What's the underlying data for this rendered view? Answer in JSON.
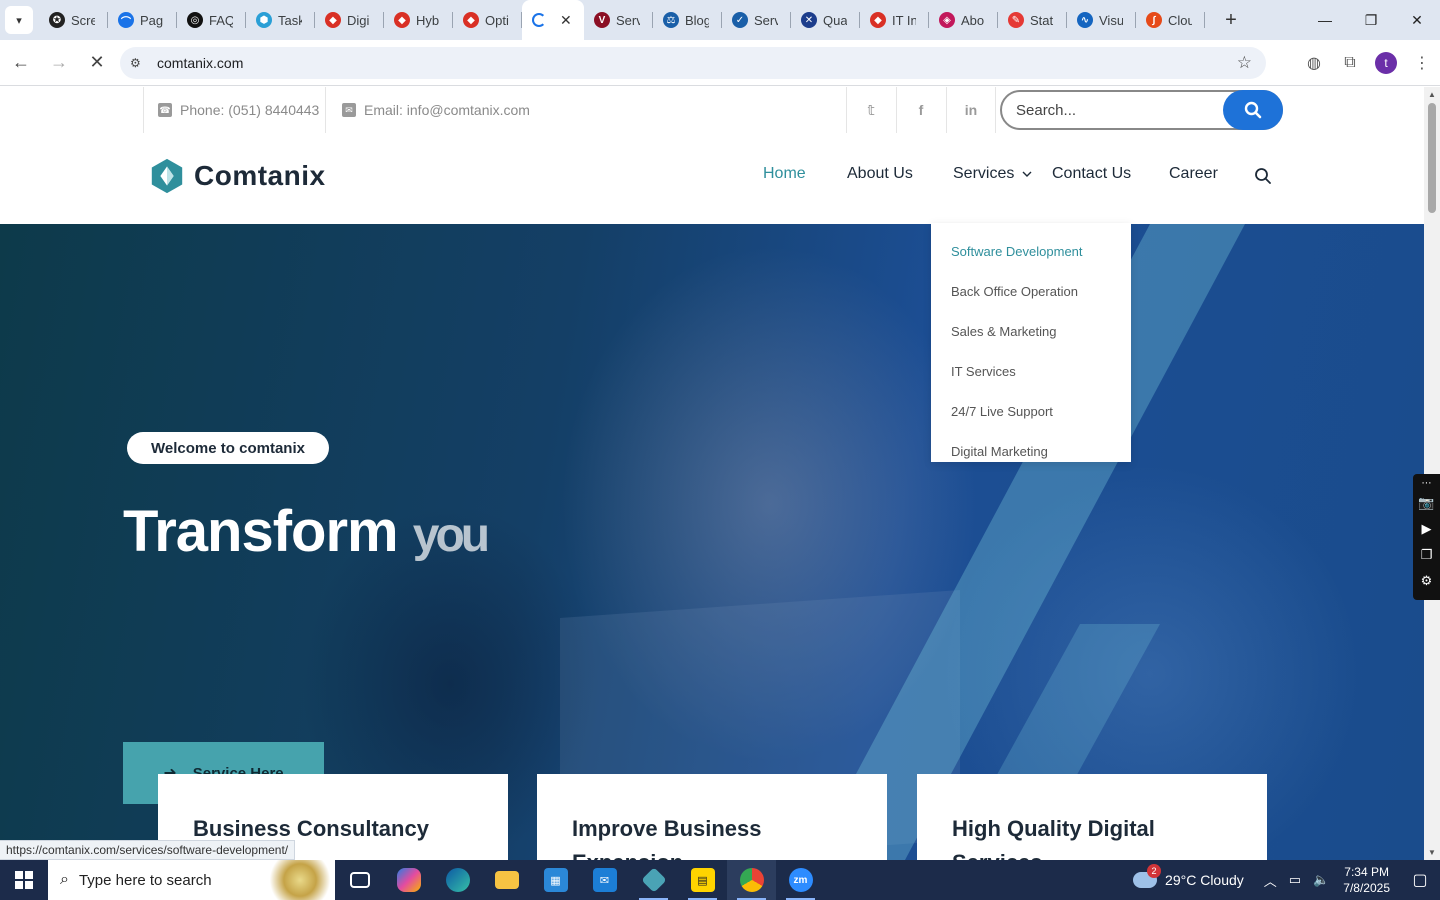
{
  "browser": {
    "tabs": [
      {
        "label": "Scre",
        "color": "#222222",
        "glyph": "✪"
      },
      {
        "label": "Pag",
        "color": "#1a73e8",
        "glyph": "⌒"
      },
      {
        "label": "FAQ",
        "color": "#111111",
        "glyph": "◎"
      },
      {
        "label": "Task",
        "color": "#2a9fd6",
        "glyph": "⬢"
      },
      {
        "label": "Digi",
        "color": "#d93025",
        "glyph": "◆"
      },
      {
        "label": "Hyb",
        "color": "#d93025",
        "glyph": "◆"
      },
      {
        "label": "Opti",
        "color": "#d93025",
        "glyph": "◆"
      },
      {
        "label": "Serv",
        "color": "#8b0f24",
        "glyph": "V"
      },
      {
        "label": "Blog",
        "color": "#1a5fa8",
        "glyph": "⚖"
      },
      {
        "label": "Serv",
        "color": "#1a5fa8",
        "glyph": "✓"
      },
      {
        "label": "Qua",
        "color": "#1c3d8c",
        "glyph": "✕"
      },
      {
        "label": "IT In",
        "color": "#d93025",
        "glyph": "◆"
      },
      {
        "label": "Abo",
        "color": "#c2185b",
        "glyph": "◈"
      },
      {
        "label": "Stat",
        "color": "#e53935",
        "glyph": "✎"
      },
      {
        "label": "Visu",
        "color": "#1565c0",
        "glyph": "∿"
      },
      {
        "label": "Clou",
        "color": "#e64a19",
        "glyph": "∫"
      }
    ],
    "url": "comtanix.com",
    "status_link": "https://comtanix.com/services/software-development/"
  },
  "topbar": {
    "phone": "Phone: (051) 8440443",
    "email": "Email: info@comtanix.com",
    "social": [
      "twitter",
      "facebook",
      "linkedin"
    ],
    "search_placeholder": "Search..."
  },
  "header": {
    "logo_text": "Comtanix",
    "brand_color": "#2f8f9c",
    "nav": [
      {
        "label": "Home",
        "active": true
      },
      {
        "label": "About Us"
      },
      {
        "label": "Services"
      },
      {
        "label": "Contact Us"
      },
      {
        "label": "Career"
      }
    ]
  },
  "services_dropdown": [
    {
      "label": "Software Development",
      "active": true
    },
    {
      "label": "Back Office Operation"
    },
    {
      "label": "Sales & Marketing"
    },
    {
      "label": "IT Services"
    },
    {
      "label": "24/7 Live Support"
    },
    {
      "label": "Digital Marketing"
    }
  ],
  "hero": {
    "badge": "Welcome to comtanix",
    "title": "Transform",
    "title_partial": "you",
    "button": "Service Here"
  },
  "cards": [
    {
      "title": "Business Consultancy"
    },
    {
      "title": "Improve Business Expansion"
    },
    {
      "title": "High Quality Digital Services"
    }
  ],
  "taskbar": {
    "search_placeholder": "Type here to search",
    "weather": "29°C  Cloudy",
    "weather_badge": "2",
    "time": "7:34 PM",
    "date": "7/8/2025"
  }
}
